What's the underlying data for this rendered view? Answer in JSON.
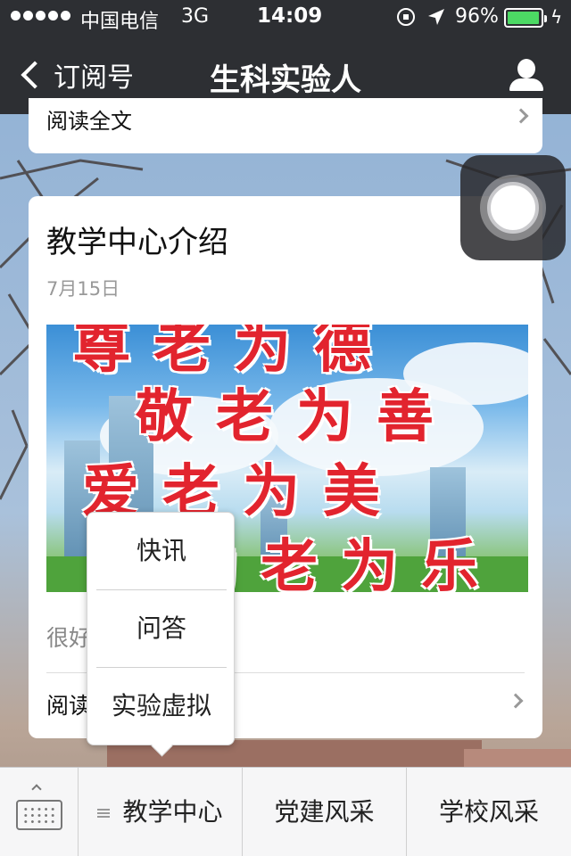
{
  "status_bar": {
    "carrier": "中国电信",
    "network": "3G",
    "time": "14:09",
    "battery_percent": "96%",
    "battery_level": 0.96,
    "icons": [
      "signal-dots-icon",
      "rotation-lock-icon",
      "location-arrow-icon",
      "battery-icon",
      "charging-icon"
    ]
  },
  "nav": {
    "back_label": "订阅号",
    "title": "生科实验人",
    "right_icon": "user-icon"
  },
  "prev_card": {
    "read_all": "阅读全文"
  },
  "card": {
    "title": "教学中心介绍",
    "date": "7月15日",
    "image_lines": [
      "尊老为德",
      "敬老为善",
      "爱老为美",
      "助老为乐"
    ],
    "summary": "很好",
    "read_all": "阅读全文"
  },
  "popup_menu": {
    "items": [
      "快讯",
      "问答",
      "实验虚拟"
    ]
  },
  "bottom_bar": {
    "keyboard_icon": "keyboard-icon",
    "tabs": [
      {
        "label": "教学中心",
        "has_menu_icon": true
      },
      {
        "label": "党建风采"
      },
      {
        "label": "学校风采"
      }
    ]
  },
  "colors": {
    "bar_dark": "#2d2f33",
    "battery_green": "#4cd964",
    "slogan_red": "#e2242e"
  }
}
